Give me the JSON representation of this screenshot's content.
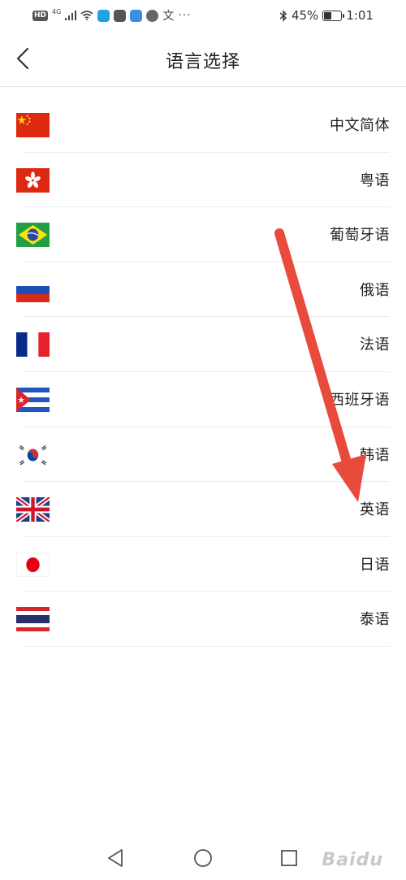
{
  "status_bar": {
    "hd": "HD",
    "net": "4G",
    "dots": "···",
    "battery_text": "45%",
    "battery_level": 0.45,
    "time": "1:01"
  },
  "header": {
    "title": "语言选择",
    "back_icon": "chevron-left-icon"
  },
  "languages": [
    {
      "label": "中文简体",
      "flag": "china-flag"
    },
    {
      "label": "粤语",
      "flag": "hong-kong-flag"
    },
    {
      "label": "葡萄牙语",
      "flag": "brazil-flag"
    },
    {
      "label": "俄语",
      "flag": "russia-flag"
    },
    {
      "label": "法语",
      "flag": "france-flag"
    },
    {
      "label": "西班牙语",
      "flag": "cuba-flag"
    },
    {
      "label": "韩语",
      "flag": "korea-flag"
    },
    {
      "label": "英语",
      "flag": "uk-flag"
    },
    {
      "label": "日语",
      "flag": "japan-flag"
    },
    {
      "label": "泰语",
      "flag": "thailand-flag"
    }
  ],
  "annotation": {
    "color": "#e84b3c",
    "icon": "red-arrow"
  },
  "nav_bar": {
    "back_icon": "triangle-back-icon",
    "home_icon": "circle-home-icon",
    "recents_icon": "square-recents-icon"
  },
  "watermark": "Baidu"
}
